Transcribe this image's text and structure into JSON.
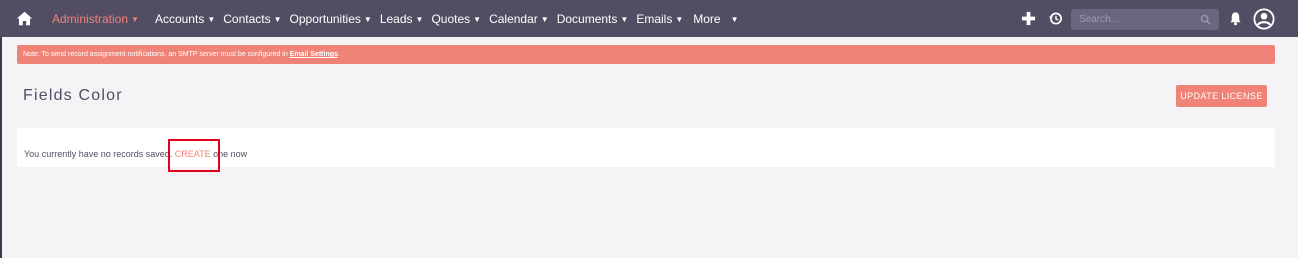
{
  "nav": {
    "items": [
      {
        "label": "Administration",
        "active": true
      },
      {
        "label": "Accounts"
      },
      {
        "label": "Contacts"
      },
      {
        "label": "Opportunities"
      },
      {
        "label": "Leads"
      },
      {
        "label": "Quotes"
      },
      {
        "label": "Calendar"
      },
      {
        "label": "Documents"
      },
      {
        "label": "Emails"
      },
      {
        "label": "More"
      }
    ],
    "search_placeholder": "Search...",
    "icons": [
      "home-icon",
      "plus-icon",
      "history-icon",
      "search-icon",
      "bell-icon",
      "user-avatar-icon"
    ]
  },
  "notice": {
    "text": "Note: To send record assignment notifications, an SMTP server must be configured in ",
    "link": "Email Settings",
    "suffix": "."
  },
  "page": {
    "title": "Fields Color",
    "update_button": "UPDATE LICENSE"
  },
  "empty_state": {
    "prefix": "You currently have no records saved. ",
    "create_link": "CREATE",
    "suffix": " one now"
  },
  "colors": {
    "topbar": "#534d64",
    "accent": "#f08377",
    "highlight": "#e0001b"
  }
}
